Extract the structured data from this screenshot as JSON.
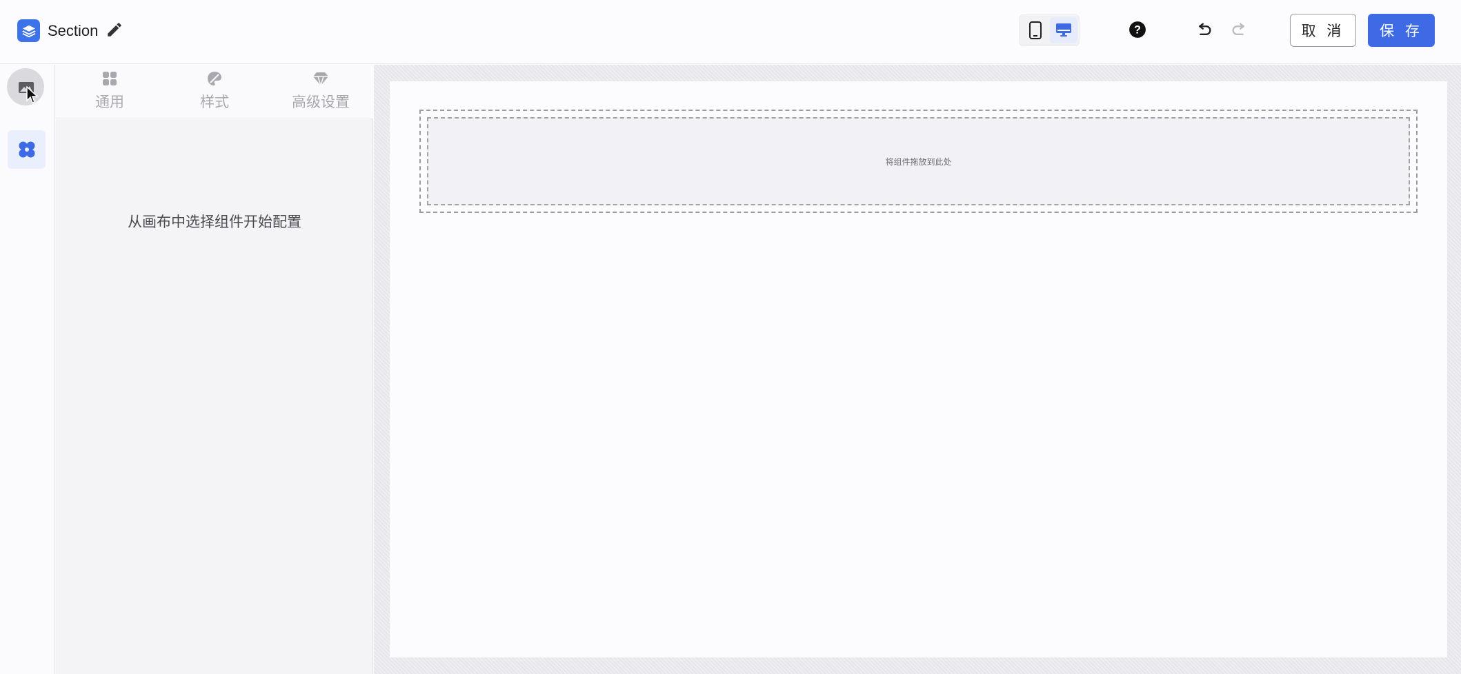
{
  "header": {
    "title": "Section",
    "logo_icon": "layers-icon",
    "edit_icon": "pencil-icon",
    "device_toggle": {
      "mobile_icon": "mobile-phone-icon",
      "desktop_icon": "desktop-monitor-icon",
      "selected": "desktop"
    },
    "help_icon": "question-circle-icon",
    "undo_icon": "undo-icon",
    "redo_icon": "redo-icon",
    "cancel_label": "取 消",
    "save_label": "保 存"
  },
  "rail": {
    "items": [
      {
        "id": "media",
        "icon": "image-icon",
        "active": false
      },
      {
        "id": "components",
        "icon": "four-petal-icon",
        "active": true
      }
    ]
  },
  "panel": {
    "tabs": [
      {
        "label": "通用",
        "icon": "grid-icon"
      },
      {
        "label": "样式",
        "icon": "palette-icon"
      },
      {
        "label": "高级设置",
        "icon": "diamond-icon"
      }
    ],
    "empty_hint": "从画布中选择组件开始配置"
  },
  "canvas": {
    "drop_hint": "将组件拖放到此处"
  },
  "colors": {
    "accent": "#3e6ae6",
    "logo": "#3d73e8",
    "rail_active_bg": "#e9effc"
  }
}
